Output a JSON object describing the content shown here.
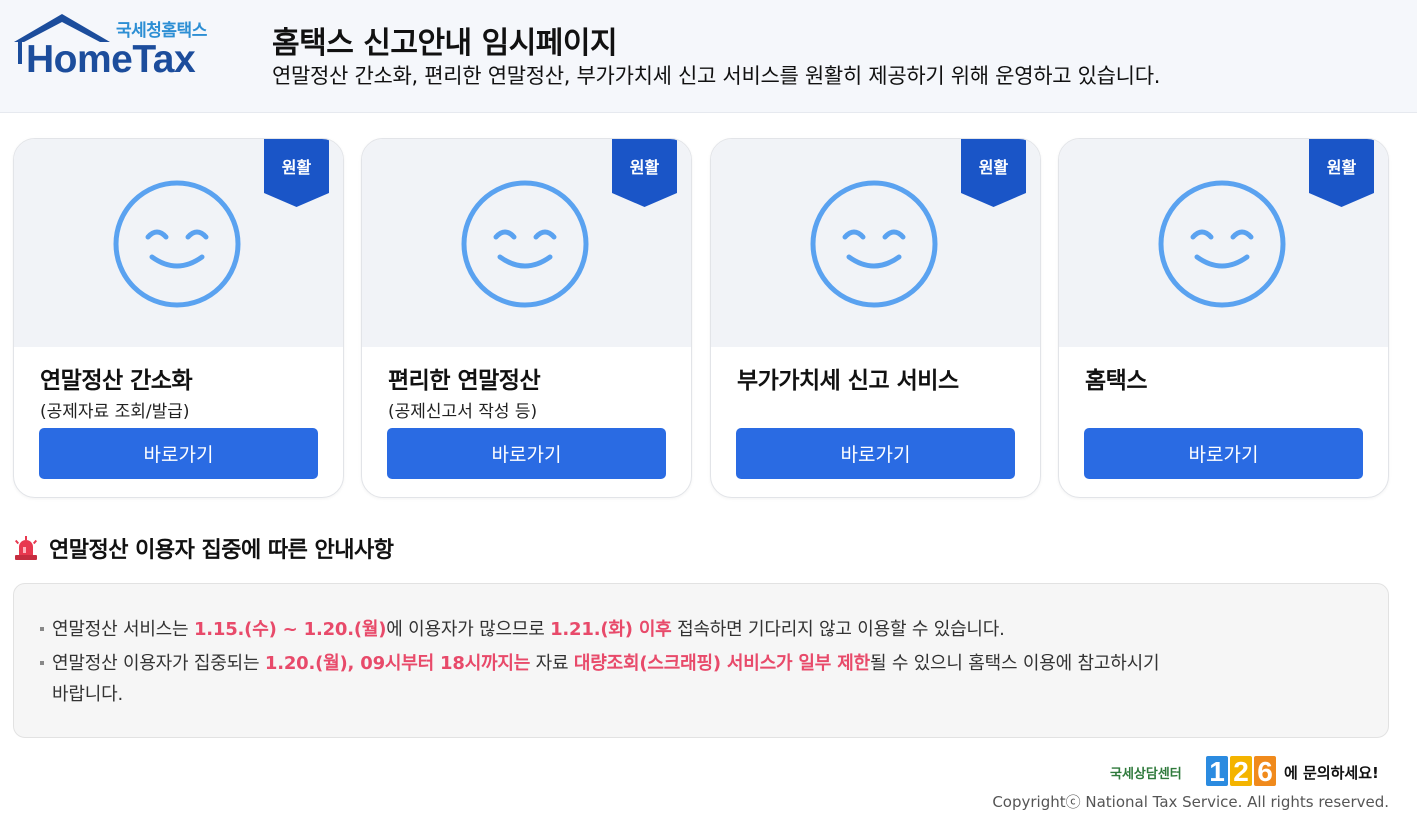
{
  "header": {
    "logo_sub": "국세청홈택스",
    "logo_main": "HomeTax",
    "title": "홈택스 신고안내 임시페이지",
    "description": "연말정산 간소화, 편리한 연말정산, 부가가치세 신고 서비스를 원활히 제공하기 위해 운영하고 있습니다."
  },
  "cards": [
    {
      "status": "원활",
      "title": "연말정산 간소화",
      "subtitle": "(공제자료 조회/발급)",
      "button": "바로가기"
    },
    {
      "status": "원활",
      "title": "편리한 연말정산",
      "subtitle": "(공제신고서 작성 등)",
      "button": "바로가기"
    },
    {
      "status": "원활",
      "title": "부가가치세 신고 서비스",
      "subtitle": "",
      "button": "바로가기"
    },
    {
      "status": "원활",
      "title": "홈택스",
      "subtitle": "",
      "button": "바로가기"
    }
  ],
  "notice": {
    "title": "연말정산 이용자 집중에 따른 안내사항",
    "item1": {
      "t1": "연말정산 서비스는 ",
      "h1": "1.15.(수) ~ 1.20.(월)",
      "t2": "에 이용자가 많으므로 ",
      "h2": "1.21.(화) 이후",
      "t3": " 접속하면 기다리지 않고 이용할 수 있습니다."
    },
    "item2": {
      "t1": "연말정산 이용자가 집중되는 ",
      "h1": "1.20.(월), 09시부터 18시까지는",
      "t2": " 자료 ",
      "h2": "대량조회(스크래핑) 서비스가 일부 제한",
      "t3": "될 수 있으니 홈택스 이용에 참고하시기",
      "t4": "바랍니다."
    }
  },
  "footer": {
    "contact_prefix": "국세상담센터",
    "contact_number": "126",
    "contact_suffix": "에 문의하세요!",
    "copyright": "Copyrightⓒ National Tax Service. All rights reserved."
  },
  "colors": {
    "accent": "#2a6be3",
    "ribbon": "#1a55c7",
    "smiley": "#5aa2f0",
    "highlight": "#e84a6a",
    "logo": "#1c4d9c"
  }
}
